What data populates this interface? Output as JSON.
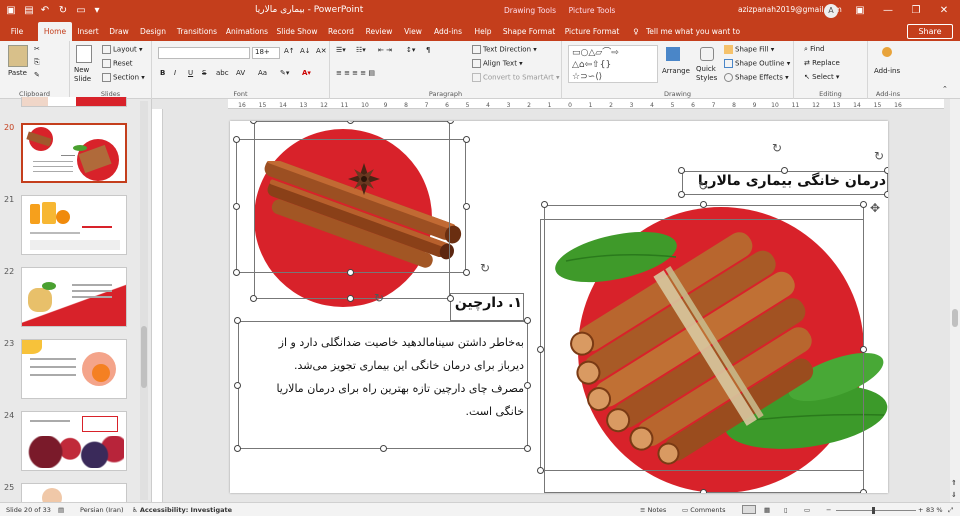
{
  "window": {
    "title": "بیماری مالاریا  -  PowerPoint",
    "context_tabs": [
      "Drawing Tools",
      "Picture Tools"
    ],
    "account": "azizpanah2019@gmail.com",
    "avatar_letter": "A"
  },
  "tabs": [
    "File",
    "Home",
    "Insert",
    "Draw",
    "Design",
    "Transitions",
    "Animations",
    "Slide Show",
    "Record",
    "Review",
    "View",
    "Add-ins",
    "Help",
    "Shape Format",
    "Picture Format"
  ],
  "active_tab": "Home",
  "tell_me": "Tell me what you want to do",
  "share_label": "Share",
  "ribbon": {
    "clipboard": {
      "paste": "Paste",
      "label": "Clipboard"
    },
    "slides": {
      "new_slide": "New Slide",
      "layout": "Layout",
      "reset": "Reset",
      "section": "Section",
      "label": "Slides"
    },
    "font": {
      "name": "",
      "size": "18+",
      "label": "Font",
      "bold": "B",
      "italic": "I",
      "underline": "U",
      "strike": "S",
      "shadow": "abc",
      "spacing": "AV",
      "case": "Aa"
    },
    "paragraph": {
      "text_direction": "Text Direction",
      "align_text": "Align Text",
      "smartart": "Convert to SmartArt",
      "label": "Paragraph"
    },
    "drawing": {
      "arrange": "Arrange",
      "quick_styles": "Quick Styles",
      "shape_fill": "Shape Fill",
      "shape_outline": "Shape Outline",
      "shape_effects": "Shape Effects",
      "label": "Drawing"
    },
    "editing": {
      "find": "Find",
      "replace": "Replace",
      "select": "Select",
      "label": "Editing"
    },
    "addins": {
      "addins": "Add-ins",
      "label": "Add-ins"
    }
  },
  "slides": [
    {
      "number": "20",
      "selected": true
    },
    {
      "number": "21",
      "selected": false
    },
    {
      "number": "22",
      "selected": false
    },
    {
      "number": "23",
      "selected": false
    },
    {
      "number": "24",
      "selected": false
    },
    {
      "number": "25",
      "selected": false
    }
  ],
  "slide": {
    "title": "درمان خانگی بیماری مالاریا",
    "heading": "۱. دارچین",
    "body_lines": [
      "به‌خاطر داشتن سینامالدهید خاصیت ضدانگلی دارد و از",
      "دیرباز برای درمان خانگی این بیماری تجویز می‌شد.",
      "مصرف چای دارچین تازه بهترین راه برای درمان مالاریا",
      "خانگی است."
    ]
  },
  "ruler_numbers": [
    "16",
    "15",
    "14",
    "13",
    "12",
    "11",
    "10",
    "9",
    "8",
    "7",
    "6",
    "5",
    "4",
    "3",
    "2",
    "1",
    "0",
    "1",
    "2",
    "3",
    "4",
    "5",
    "6",
    "7",
    "8",
    "9",
    "10",
    "11",
    "12",
    "13",
    "14",
    "15",
    "16"
  ],
  "status": {
    "slide_count": "Slide 20 of 33",
    "language": "Persian (Iran)",
    "accessibility": "Accessibility: Investigate",
    "notes": "Notes",
    "comments": "Comments",
    "zoom": "83 %"
  },
  "colors": {
    "accent": "#c43e1c",
    "slide_red": "#d8222a"
  }
}
